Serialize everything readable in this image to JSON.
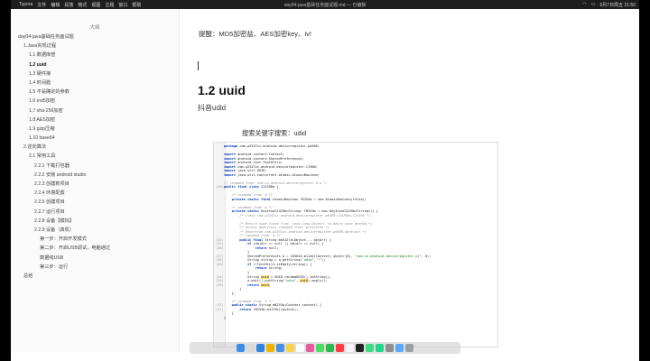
{
  "menubar": {
    "app": "Typora",
    "menus": [
      "文件",
      "编辑",
      "段落",
      "格式",
      "视图",
      "主题",
      "窗口",
      "帮助"
    ],
    "window_title": "day04-java基础任务面试题.md — 已编辑",
    "clock": "6月7日周五 21:50"
  },
  "sidebar": {
    "header": "大纲",
    "items": [
      {
        "label": "day04-java基础任务面试题",
        "level": 0,
        "active": false
      },
      {
        "label": "1.Java实现过程",
        "level": 1,
        "active": false
      },
      {
        "label": "1.1 数据库管",
        "level": 2,
        "active": false
      },
      {
        "label": "1.2 uuid",
        "level": 2,
        "active": true
      },
      {
        "label": "1.3 硬件接",
        "level": 2,
        "active": false
      },
      {
        "label": "1.4 时间戳",
        "level": 2,
        "active": false
      },
      {
        "label": "1.5 不是确定的参数",
        "level": 2,
        "active": false
      },
      {
        "label": "1.6 md5加密",
        "level": 2,
        "active": false
      },
      {
        "label": "1.7 sha-256加密",
        "level": 2,
        "active": false
      },
      {
        "label": "1.8 AES加密",
        "level": 2,
        "active": false
      },
      {
        "label": "1.9 gzip压缩",
        "level": 2,
        "active": false
      },
      {
        "label": "1.10 base64",
        "level": 2,
        "active": false
      },
      {
        "label": "2.逆向算法",
        "level": 1,
        "active": false
      },
      {
        "label": "2.1 常用工具",
        "level": 2,
        "active": false
      },
      {
        "label": "2.2.1 下载打包器",
        "level": 3,
        "active": false
      },
      {
        "label": "2.2.2 安装 android studio",
        "level": 3,
        "active": false
      },
      {
        "label": "2.2.3 创建新项目",
        "level": 3,
        "active": false
      },
      {
        "label": "2.2.4 环境配置",
        "level": 3,
        "active": false
      },
      {
        "label": "2.2.5 创建项目",
        "level": 3,
        "active": false
      },
      {
        "label": "2.2.7 运行项目",
        "level": 3,
        "active": false
      },
      {
        "label": "2.2.8 设备【模拟】",
        "level": 3,
        "active": false
      },
      {
        "label": "2.2.9 设备（真机）",
        "level": 3,
        "active": false
      },
      {
        "label": "第一步：开启开发模式",
        "level": 4,
        "active": false
      },
      {
        "label": "第二步：开启USB调试，电脑通过",
        "level": 4,
        "active": false
      },
      {
        "label": "数据线USB",
        "level": 4,
        "active": false
      },
      {
        "label": "第三步：运行",
        "level": 4,
        "active": false
      },
      {
        "label": "总结",
        "level": 1,
        "active": false
      }
    ]
  },
  "main": {
    "line1": "提醒：MD5加密盐、AES加密key、iv!",
    "heading": "1.2 uuid",
    "para": "抖音udid",
    "caption": "搜索关键字搜索：udid"
  },
  "code": {
    "lines": [
      {
        "n": "",
        "segs": [
          [
            "kw",
            "package "
          ],
          [
            "pl",
            "com.p2347zz.android.deviceregister.p0486;"
          ]
        ]
      },
      {
        "n": "",
        "segs": [
          [
            "pl",
            ""
          ]
        ]
      },
      {
        "n": "",
        "segs": [
          [
            "kw",
            "import "
          ],
          [
            "pl",
            "android.content.Context;"
          ]
        ]
      },
      {
        "n": "",
        "segs": [
          [
            "kw",
            "import "
          ],
          [
            "pl",
            "android.content.SharedPreferences;"
          ]
        ]
      },
      {
        "n": "",
        "segs": [
          [
            "kw",
            "import "
          ],
          [
            "pl",
            "android.text.TextUtils;"
          ]
        ]
      },
      {
        "n": "",
        "segs": [
          [
            "kw",
            "import "
          ],
          [
            "pl",
            "com.p2347zz.android.deviceregister.C1908;"
          ]
        ]
      },
      {
        "n": "",
        "segs": [
          [
            "kw",
            "import "
          ],
          [
            "pl",
            "java.util.UUID;"
          ]
        ]
      },
      {
        "n": "",
        "segs": [
          [
            "kw",
            "import "
          ],
          [
            "pl",
            "java.util.concurrent.atomic.AtomicBoolean;"
          ]
        ]
      },
      {
        "n": "",
        "segs": [
          [
            "pl",
            ""
          ]
        ]
      },
      {
        "n": "",
        "segs": [
          [
            "cm",
            "/* renamed from: com.ss.android.deviceregister.d.a */"
          ]
        ]
      },
      {
        "n": "(26)",
        "segs": [
          [
            "kw",
            "public final class "
          ],
          [
            "pl",
            "C2429Ba {"
          ]
        ]
      },
      {
        "n": "",
        "segs": [
          [
            "pl",
            ""
          ]
        ]
      },
      {
        "n": "",
        "segs": [
          [
            "cm",
            "    /* renamed from: a */"
          ]
        ]
      },
      {
        "n": "",
        "segs": [
          [
            "kw",
            "    private static final "
          ],
          [
            "pl",
            "AtomicBoolean f8254a = new AtomicBoolean(false);"
          ]
        ]
      },
      {
        "n": "",
        "segs": [
          [
            "pl",
            ""
          ]
        ]
      },
      {
        "n": "",
        "segs": [
          [
            "cm",
            "    /* renamed from: b */"
          ]
        ]
      },
      {
        "n": "",
        "segs": [
          [
            "kw",
            "    private static "
          ],
          [
            "pl",
            "KeyInvoC2429b<String> f8253b = new KeyInvoC2429b<String>() {"
          ]
        ]
      },
      {
        "n": "",
        "segs": [
          [
            "cm",
            "        /* class com.p2347zz.android.deviceregister.p0486.C2429Ba.C24291 */"
          ]
        ]
      },
      {
        "n": "",
        "segs": [
          [
            "pl",
            ""
          ]
        ]
      },
      {
        "n": "",
        "segs": [
          [
            "cm",
            "        /* Return type fixed from 'java.lang.Object' to match base method */"
          ]
        ]
      },
      {
        "n": "",
        "segs": [
          [
            "cm",
            "        /* access modifiers changed from: protected */"
          ]
        ]
      },
      {
        "n": "",
        "segs": [
          [
            "cm",
            "        /* @Override com.p2347zz.android.deviceregister.p0486.Abstract */"
          ]
        ]
      },
      {
        "n": "",
        "segs": [
          [
            "cm",
            "        /* renamed from: a */"
          ]
        ]
      },
      {
        "n": "(32)",
        "segs": [
          [
            "kw",
            "        public final "
          ],
          [
            "pl",
            "String mo5127a(Object... objArr) {"
          ]
        ]
      },
      {
        "n": "(32)",
        "segs": [
          [
            "kw",
            "            if "
          ],
          [
            "pl",
            "(objArr == null || objArr == null) {"
          ]
        ]
      },
      {
        "n": "(40)",
        "segs": [
          [
            "kw",
            "                return "
          ],
          [
            "pl",
            "null;"
          ]
        ]
      },
      {
        "n": "",
        "segs": [
          [
            "pl",
            "            }"
          ]
        ]
      },
      {
        "n": "(47)",
        "segs": [
          [
            "pl",
            "            SharedPreferences a = C0364d.m1140(Context) objArr[0], "
          ],
          [
            "st",
            "\"com.ss.android.deviceregister.ut\""
          ],
          [
            "pl",
            ", 0);"
          ]
        ]
      },
      {
        "n": "(48)",
        "segs": [
          [
            "pl",
            "            String string = a.getString("
          ],
          [
            "st",
            "\"udid\""
          ],
          [
            "pl",
            ", \"\");"
          ]
        ]
      },
      {
        "n": "(49)",
        "segs": [
          [
            "kw",
            "            if "
          ],
          [
            "pl",
            "(!TextUtils.isEmpty(string)) {"
          ]
        ]
      },
      {
        "n": "",
        "segs": [
          [
            "kw",
            "                return "
          ],
          [
            "pl",
            "string;"
          ]
        ]
      },
      {
        "n": "",
        "segs": [
          [
            "pl",
            "            }"
          ]
        ]
      },
      {
        "n": "(34)",
        "segs": [
          [
            "pl",
            "            String "
          ],
          [
            "hl",
            "uuid"
          ],
          [
            "pl",
            " = UUID.randomUUID().toString();"
          ]
        ]
      },
      {
        "n": "(35)",
        "segs": [
          [
            "pl",
            "            a.edit().putString("
          ],
          [
            "st",
            "\"udid\""
          ],
          [
            "pl",
            ", "
          ],
          [
            "hl",
            "uuid"
          ],
          [
            "pl",
            ").apply();"
          ]
        ]
      },
      {
        "n": "(36)",
        "segs": [
          [
            "kw",
            "            return "
          ],
          [
            "hl",
            "uuid"
          ],
          [
            "pl",
            ";"
          ]
        ]
      },
      {
        "n": "",
        "segs": [
          [
            "pl",
            "        }"
          ]
        ]
      },
      {
        "n": "",
        "segs": [
          [
            "pl",
            "    };"
          ]
        ]
      },
      {
        "n": "",
        "segs": [
          [
            "pl",
            ""
          ]
        ]
      },
      {
        "n": "",
        "segs": [
          [
            "cm",
            "    /* renamed from: a */"
          ]
        ]
      },
      {
        "n": "(37)",
        "segs": [
          [
            "kw",
            "    public static "
          ],
          [
            "pl",
            "String m8253a(Context context) {"
          ]
        ]
      },
      {
        "n": "(37)",
        "segs": [
          [
            "kw",
            "        return "
          ],
          [
            "pl",
            "f8254b.m4173b(context);"
          ]
        ]
      },
      {
        "n": "",
        "segs": [
          [
            "pl",
            "    }"
          ]
        ]
      },
      {
        "n": "",
        "segs": [
          [
            "pl",
            "}"
          ]
        ]
      }
    ]
  },
  "dock": {
    "icons": [
      "finder-icon",
      "launchpad-icon",
      "safari-icon",
      "chrome-icon",
      "mail-icon",
      "notes-icon",
      "calendar-icon",
      "photos-icon",
      "messages-icon",
      "wechat-icon",
      "music-icon",
      "typora-icon",
      "terminal-icon",
      "android-studio-icon",
      "pycharm-icon",
      "settings-icon",
      "folder-icon",
      "trash-icon"
    ],
    "colors": [
      "#3b8fe6",
      "#d9d9d9",
      "#2f86e0",
      "#f0b400",
      "#4a90e2",
      "#f6d34a",
      "#ffffff",
      "#e85aa0",
      "#4cd964",
      "#2dbb4e",
      "#fc3c44",
      "#f5f5f5",
      "#222222",
      "#3ddc84",
      "#21d789",
      "#8e8e93",
      "#5aa9ff",
      "#9aa0a6"
    ]
  }
}
